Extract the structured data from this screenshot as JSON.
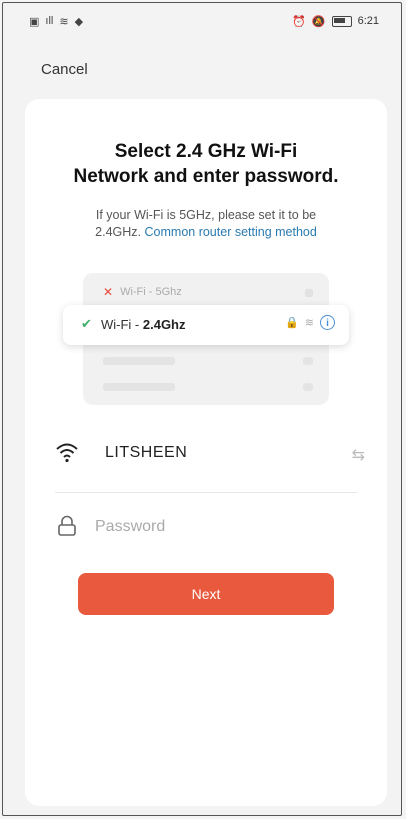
{
  "status_bar": {
    "left_icons": [
      "sim-icon",
      "signal-icon",
      "wifi-icon",
      "notification-icon"
    ],
    "right_icons": [
      "alarm-icon",
      "mute-icon",
      "battery-icon"
    ],
    "time": "6:21"
  },
  "header": {
    "cancel_label": "Cancel"
  },
  "card": {
    "title_line1": "Select 2.4 GHz Wi-Fi",
    "title_line2": "Network and enter password.",
    "hint_line1": "If your Wi-Fi is 5GHz, please set it to be",
    "hint_prefix": "2.4GHz.",
    "hint_link": "Common router setting method"
  },
  "illustration": {
    "network_5g": "Wi-Fi - 5Ghz",
    "network_24_prefix": "Wi-Fi - ",
    "network_24_band": "2.4Ghz"
  },
  "wifi": {
    "ssid": "LITSHEEN"
  },
  "password": {
    "placeholder": "Password",
    "value": ""
  },
  "actions": {
    "next_label": "Next"
  },
  "colors": {
    "accent_button": "#e9593d",
    "link": "#2a7ab0",
    "check": "#3db06a",
    "cross": "#e54a3b"
  }
}
